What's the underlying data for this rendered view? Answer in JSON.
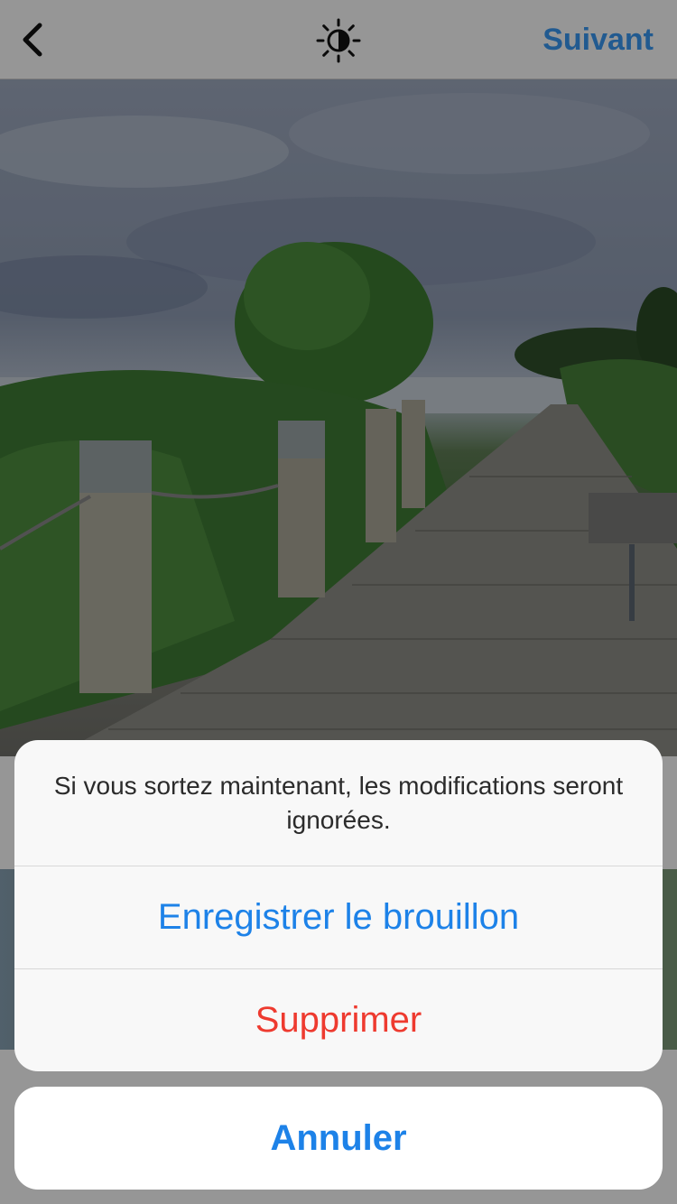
{
  "header": {
    "back_icon": "chevron-left-icon",
    "brightness_icon": "brightness-icon",
    "next_label": "Suivant"
  },
  "dialog": {
    "message": "Si vous sortez maintenant, les modifications seront ignorées.",
    "save_draft_label": "Enregistrer le brouillon",
    "delete_label": "Supprimer",
    "cancel_label": "Annuler"
  },
  "colors": {
    "action_blue": "#1d82e8",
    "destructive_red": "#ee3a2f",
    "accent_blue": "#3897f0"
  }
}
